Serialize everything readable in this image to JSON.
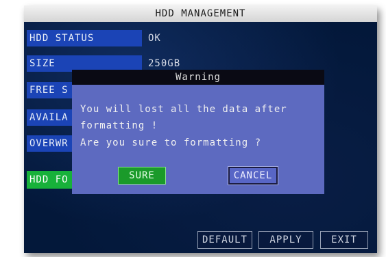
{
  "window": {
    "title": "HDD MANAGEMENT"
  },
  "fields": [
    {
      "label": "HDD STATUS",
      "value": "OK"
    },
    {
      "label": "SIZE",
      "value": "250GB"
    },
    {
      "label": "FREE S",
      "value": ""
    },
    {
      "label": "AVAILA",
      "value": ""
    },
    {
      "label": "OVERWR",
      "value": ""
    }
  ],
  "format_button": {
    "label": "HDD FO"
  },
  "dialog": {
    "title": "Warning",
    "lines": [
      "You will lost all the data after",
      "formatting !",
      "Are you sure to formatting ?"
    ],
    "sure_label": "SURE",
    "cancel_label": "CANCEL"
  },
  "footer": {
    "default_label": "DEFAULT",
    "apply_label": "APPLY",
    "exit_label": "EXIT"
  },
  "colors": {
    "background": "#03183a",
    "label_bg": "#1b44b6",
    "dialog_bg": "#5d6ac0",
    "accent_green": "#17b13a"
  }
}
